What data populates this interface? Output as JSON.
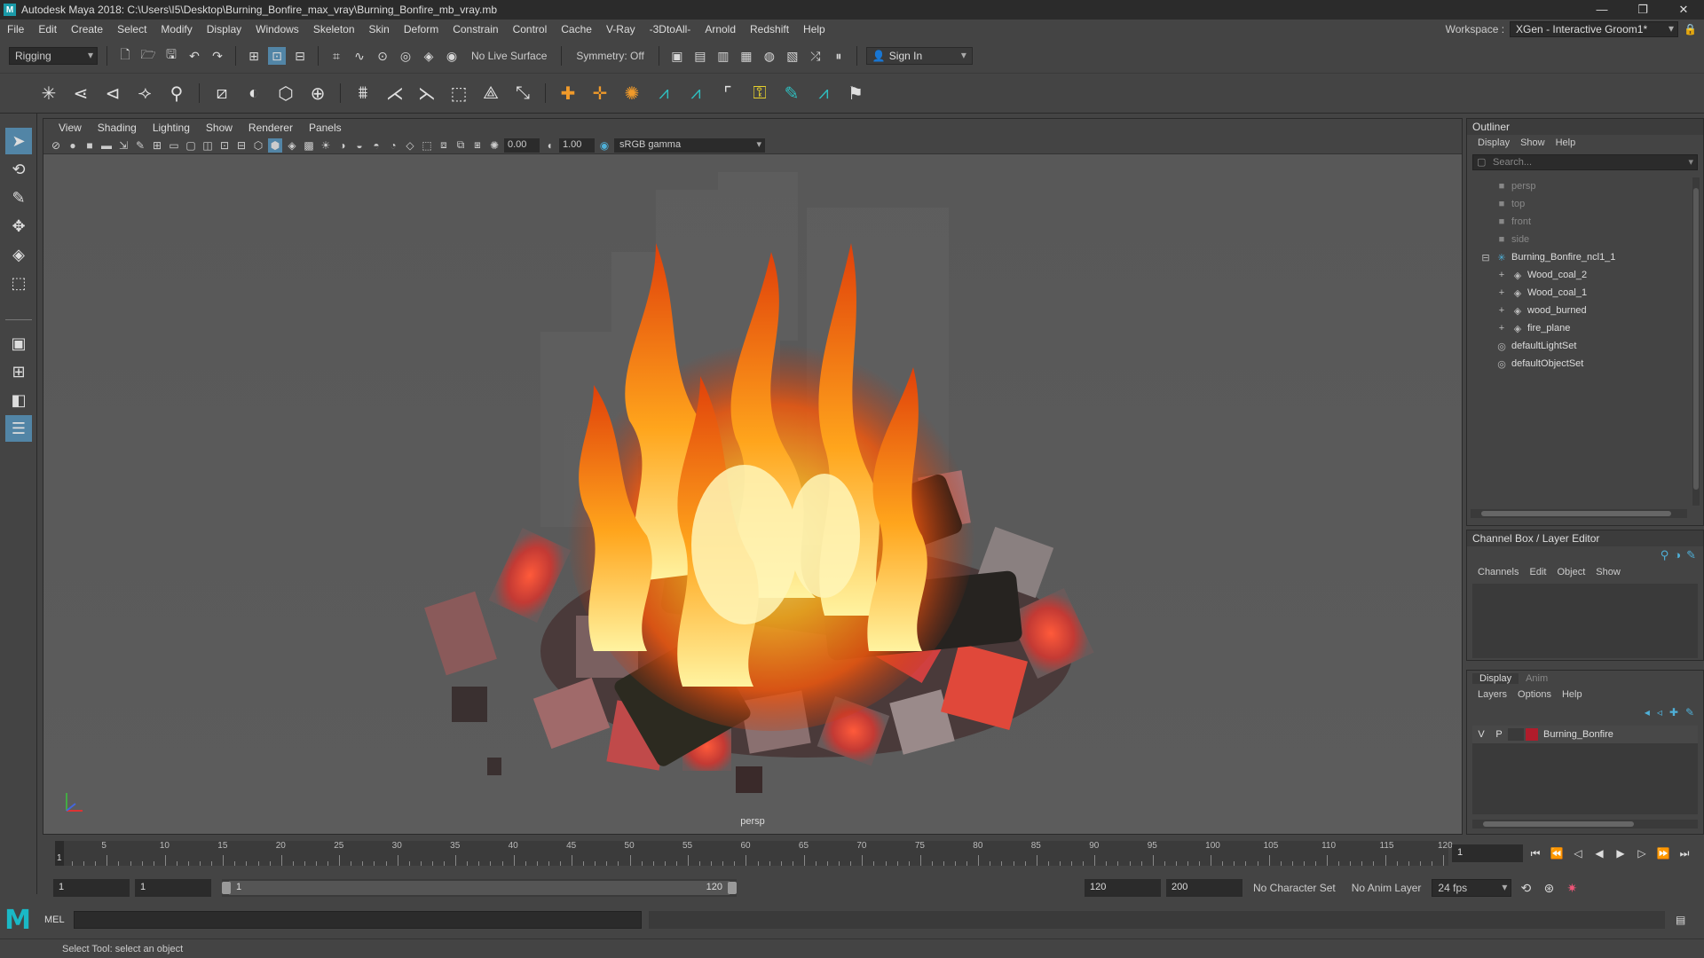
{
  "window": {
    "title": "Autodesk Maya 2018: C:\\Users\\I5\\Desktop\\Burning_Bonfire_max_vray\\Burning_Bonfire_mb_vray.mb",
    "app_icon": "M",
    "minimize": "—",
    "restore": "❐",
    "close": "✕"
  },
  "menubar": {
    "items": [
      "File",
      "Edit",
      "Create",
      "Select",
      "Modify",
      "Display",
      "Windows",
      "Skeleton",
      "Skin",
      "Deform",
      "Constrain",
      "Control",
      "Cache",
      "V-Ray",
      "-3DtoAll-",
      "Arnold",
      "Redshift",
      "Help"
    ],
    "workspace_label": "Workspace :",
    "workspace_value": "XGen - Interactive Groom1*"
  },
  "statusline": {
    "menuset": "Rigging",
    "live_surface": "No Live Surface",
    "symmetry": "Symmetry: Off",
    "sign_in": "Sign In"
  },
  "toolbox": {
    "icons": [
      "select-arrow-icon",
      "lasso-icon",
      "paint-select-icon",
      "move-icon",
      "rotate-icon",
      "scale-icon"
    ]
  },
  "viewport": {
    "menu": [
      "View",
      "Shading",
      "Lighting",
      "Show",
      "Renderer",
      "Panels"
    ],
    "exposure": "0.00",
    "gamma": "1.00",
    "color_space": "sRGB gamma",
    "camera_label": "persp"
  },
  "outliner": {
    "title": "Outliner",
    "menu": [
      "Display",
      "Show",
      "Help"
    ],
    "search_placeholder": "Search...",
    "items": [
      {
        "label": "persp",
        "icon": "camera-icon",
        "dim": true
      },
      {
        "label": "top",
        "icon": "camera-icon",
        "dim": true
      },
      {
        "label": "front",
        "icon": "camera-icon",
        "dim": true
      },
      {
        "label": "side",
        "icon": "camera-icon",
        "dim": true
      },
      {
        "label": "Burning_Bonfire_ncl1_1",
        "icon": "group-icon",
        "dim": false
      },
      {
        "label": "Wood_coal_2",
        "icon": "mesh-icon",
        "dim": false
      },
      {
        "label": "Wood_coal_1",
        "icon": "mesh-icon",
        "dim": false
      },
      {
        "label": "wood_burned",
        "icon": "mesh-icon",
        "dim": false
      },
      {
        "label": "fire_plane",
        "icon": "mesh-icon",
        "dim": false
      },
      {
        "label": "defaultLightSet",
        "icon": "set-icon",
        "dim": false
      },
      {
        "label": "defaultObjectSet",
        "icon": "set-icon",
        "dim": false
      }
    ]
  },
  "channelbox": {
    "title": "Channel Box / Layer Editor",
    "menu": [
      "Channels",
      "Edit",
      "Object",
      "Show"
    ]
  },
  "layereditor": {
    "tabs": [
      "Display",
      "Anim"
    ],
    "menu": [
      "Layers",
      "Options",
      "Help"
    ],
    "layer": {
      "v": "V",
      "p": "P",
      "name": "Burning_Bonfire",
      "color": "#b01c2b"
    }
  },
  "timeslider": {
    "ticks": [
      "5",
      "10",
      "15",
      "20",
      "25",
      "30",
      "35",
      "40",
      "45",
      "50",
      "55",
      "60",
      "65",
      "70",
      "75",
      "80",
      "85",
      "90",
      "95",
      "100",
      "105",
      "110",
      "115",
      "120"
    ],
    "current_frame": "1",
    "current_frame_field": "1"
  },
  "rangeslider": {
    "start": "1",
    "playback_start": "1",
    "range_left": "1",
    "range_right": "120",
    "playback_end": "120",
    "end": "200",
    "character_set": "No Character Set",
    "anim_layer": "No Anim Layer",
    "fps": "24 fps"
  },
  "cmdline": {
    "label": "MEL"
  },
  "helpline": {
    "text": "Select Tool: select an object"
  },
  "colors": {
    "accent": "#5285a6",
    "maya_teal": "#1ab8c5",
    "layer_red": "#b01c2b"
  }
}
